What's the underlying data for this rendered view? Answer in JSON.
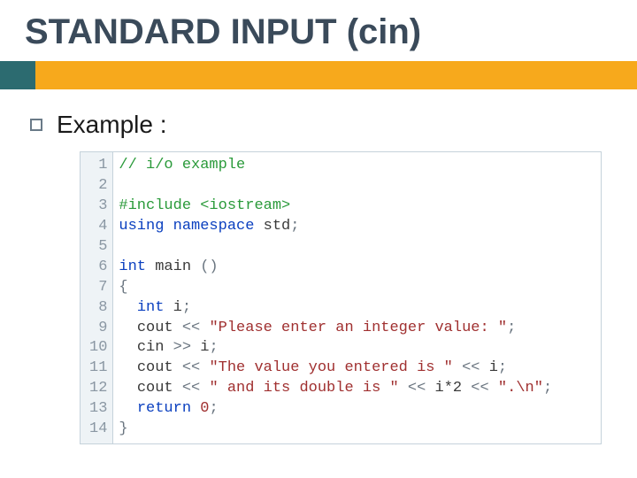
{
  "heading": "STANDARD INPUT (cin)",
  "bullet": "Example :",
  "code": {
    "linenos": [
      "1",
      "2",
      "3",
      "4",
      "5",
      "6",
      "7",
      "8",
      "9",
      "10",
      "11",
      "12",
      "13",
      "14"
    ],
    "lines": {
      "l1": {
        "comment": "// i/o example"
      },
      "l2": {},
      "l3": {
        "pp_pragma": "#include",
        "pp_rest": " <iostream>"
      },
      "l4": {
        "kw1": "using",
        "kw2": "namespace",
        "id": "std",
        "semi": ";"
      },
      "l5": {},
      "l6": {
        "ty": "int",
        "id": "main",
        "parens": " ()"
      },
      "l7": {
        "brace": "{"
      },
      "l8": {
        "indent": "  ",
        "ty": "int",
        "id": "i",
        "semi": ";"
      },
      "l9": {
        "indent": "  ",
        "id": "cout",
        "op": " << ",
        "str": "\"Please enter an integer value: \"",
        "semi": ";"
      },
      "l10": {
        "indent": "  ",
        "id": "cin",
        "op": " >> ",
        "id2": "i",
        "semi": ";"
      },
      "l11": {
        "indent": "  ",
        "id": "cout",
        "op": " << ",
        "str": "\"The value you entered is \"",
        "op2": " << ",
        "id2": "i",
        "semi": ";"
      },
      "l12": {
        "indent": "  ",
        "id": "cout",
        "op": " << ",
        "str": "\" and its double is \"",
        "op2": " << ",
        "expr": "i*2",
        "op3": " << ",
        "str2": "\".\\n\"",
        "semi": ";"
      },
      "l13": {
        "indent": "  ",
        "kw": "return",
        "sp": " ",
        "num": "0",
        "semi": ";"
      },
      "l14": {
        "brace": "}"
      }
    }
  }
}
